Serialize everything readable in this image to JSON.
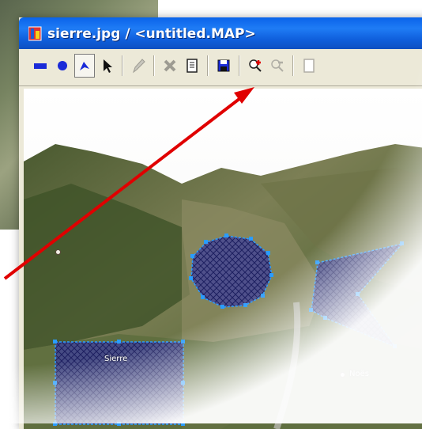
{
  "window": {
    "title": "sierre.jpg / <untitled.MAP>"
  },
  "toolbar": {
    "buttons": [
      {
        "name": "rectangle-tool",
        "icon": "rectangle-icon"
      },
      {
        "name": "circle-tool",
        "icon": "circle-icon"
      },
      {
        "name": "polygon-tool",
        "icon": "polygon-icon",
        "selected": true
      },
      {
        "name": "select-tool",
        "icon": "pointer-icon"
      },
      {
        "name": "edit-tool",
        "icon": "pencil-icon",
        "disabled": true
      },
      {
        "name": "delete-tool",
        "icon": "delete-icon",
        "disabled": true
      },
      {
        "name": "properties-button",
        "icon": "document-icon"
      },
      {
        "name": "save-button",
        "icon": "floppy-disk-icon"
      },
      {
        "name": "zoom-in-button",
        "icon": "zoom-in-icon"
      },
      {
        "name": "zoom-out-button",
        "icon": "zoom-out-icon",
        "disabled": true
      }
    ]
  },
  "map": {
    "place_labels": {
      "sierre": "Sierre",
      "noes": "Noës"
    }
  },
  "colors": {
    "titlebar": "#0a63ea",
    "shape_fill": "#3d3f9a",
    "shape_outline": "#1e90ff",
    "arrow": "#e00000"
  }
}
